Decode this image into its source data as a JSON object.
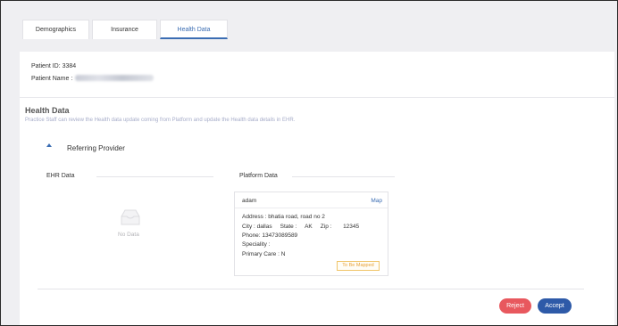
{
  "tabs": [
    {
      "label": "Demographics"
    },
    {
      "label": "Insurance"
    },
    {
      "label": "Health Data"
    }
  ],
  "patient": {
    "id_text": "Patient ID: 3384",
    "name_label": "Patient Name :"
  },
  "health": {
    "title": "Health Data",
    "description": "Practice Staff can review the Health data update coming from Platform and update the Health data details in EHR."
  },
  "referring": {
    "title": "Referring Provider",
    "ehr_label": "EHR Data",
    "platform_label": "Platform Data",
    "no_data": "No Data",
    "platform_card": {
      "name": "adam",
      "map_link": "Map",
      "address": "Address : bhatia road, road no 2",
      "city_state_zip": "City : dallas     State :     AK     Zip :       12345",
      "phone": "Phone: 13473089589",
      "speciality": "Speciality :",
      "primary_care": "Primary Care : N",
      "status_badge": "To Be Mapped"
    }
  },
  "actions": {
    "reject": "Reject",
    "accept": "Accept"
  },
  "colors": {
    "accent": "#3b6db3",
    "reject": "#e8585e",
    "accept": "#2e5aa8",
    "badge": "#e8a33a"
  }
}
